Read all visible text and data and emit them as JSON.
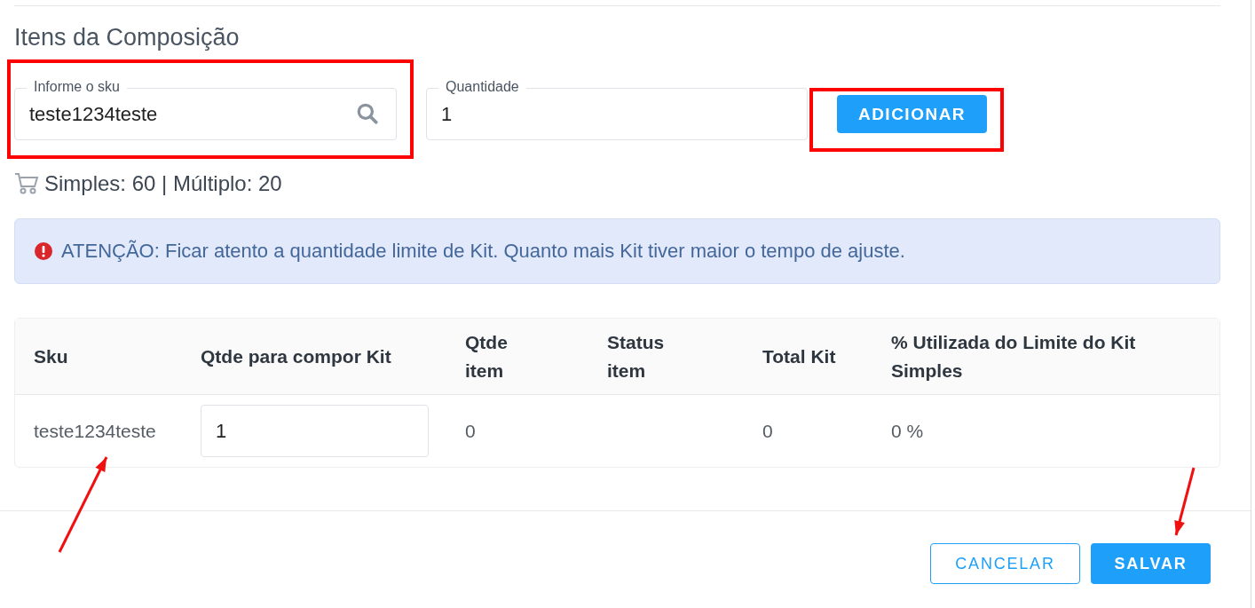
{
  "section_title": "Itens da Composição",
  "sku_field": {
    "label": "Informe o sku",
    "value": "teste1234teste"
  },
  "quantity_field": {
    "label": "Quantidade",
    "value": "1"
  },
  "add_button": "ADICIONAR",
  "summary": "Simples: 60 | Múltiplo: 20",
  "alert": {
    "text": "ATENÇÃO: Ficar atento a quantidade limite de Kit. Quanto mais Kit tiver maior o tempo de ajuste."
  },
  "table": {
    "columns": [
      "Sku",
      "Qtde para compor Kit",
      "Qtde item",
      "Status item",
      "Total Kit",
      "% Utilizada do Limite do Kit Simples"
    ],
    "rows": [
      {
        "sku": "teste1234teste",
        "quantity": "1",
        "qtde_item": "0",
        "total_kit": "0",
        "percent": "0 %"
      }
    ]
  },
  "buttons": [
    {
      "label": "CANCELAR",
      "kind": "outline"
    },
    {
      "label": "SALVAR",
      "kind": "primary"
    }
  ],
  "annotations": [
    {
      "kind": "frame"
    },
    {
      "kind": "frame"
    },
    {
      "kind": "arrow"
    },
    {
      "kind": "arrow"
    }
  ]
}
